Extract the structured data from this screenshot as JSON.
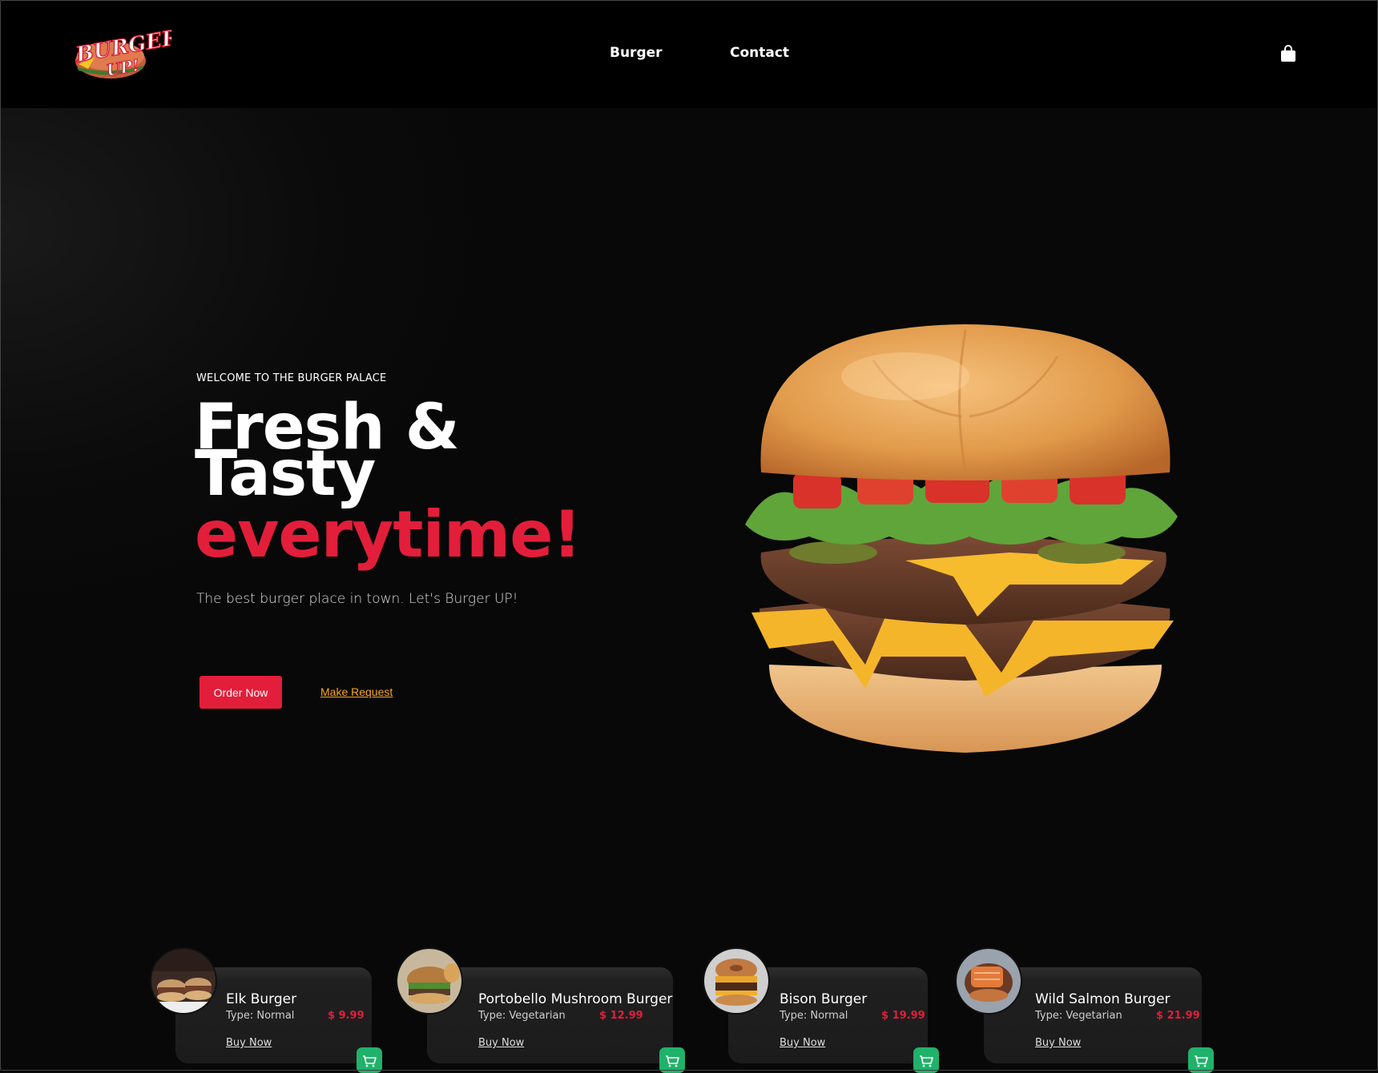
{
  "brand": {
    "logo_text_line1": "BURGER",
    "logo_text_line2": "UP!"
  },
  "nav": {
    "items": [
      "Burger",
      "Contact"
    ]
  },
  "hero": {
    "eyebrow": "WELCOME TO THE BURGER PALACE",
    "headline_line1": "Fresh &",
    "headline_line2": "Tasty",
    "headline_line3": "everytime!",
    "tagline": "The best burger place in town. Let's Burger UP!",
    "primary_button": "Order Now",
    "secondary_link": "Make Request"
  },
  "menu": {
    "items": [
      {
        "name": "Elk Burger",
        "type": "Type: Normal",
        "price": "$ 9.99",
        "buy": "Buy Now"
      },
      {
        "name": "Portobello Mushroom Burger",
        "type": "Type: Vegetarian",
        "price": "$ 12.99",
        "buy": "Buy Now"
      },
      {
        "name": "Bison Burger",
        "type": "Type: Normal",
        "price": "$ 19.99",
        "buy": "Buy Now"
      },
      {
        "name": "Wild Salmon Burger",
        "type": "Type: Vegetarian",
        "price": "$ 21.99",
        "buy": "Buy Now"
      }
    ]
  },
  "colors": {
    "accent_red": "#e21e3a",
    "link_orange": "#f5a623",
    "cart_green": "#20b26a",
    "background": "#080808"
  },
  "icons": {
    "header_cart": "shopping-bag-icon",
    "card_cart": "shopping-cart-icon"
  }
}
